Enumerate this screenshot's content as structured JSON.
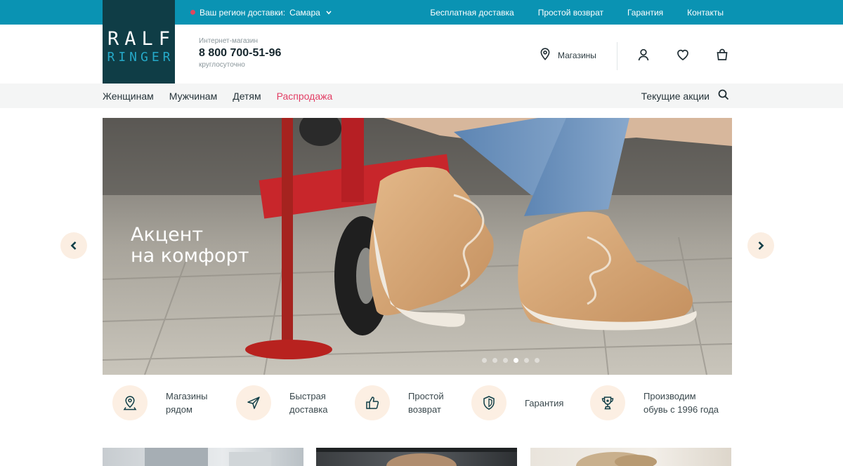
{
  "topbar": {
    "region_label": "Ваш регион доставки:",
    "region_city": "Самара",
    "links": [
      "Бесплатная доставка",
      "Простой возврат",
      "Гарантия",
      "Контакты"
    ]
  },
  "logo": {
    "line1": "RALF",
    "line2": "RINGER"
  },
  "header": {
    "phone_caption": "Интернет-магазин",
    "phone": "8 800 700-51-96",
    "phone_sub": "круглосуточно",
    "stores_label": "Магазины"
  },
  "nav": {
    "items": [
      "Женщинам",
      "Мужчинам",
      "Детям",
      "Распродажа"
    ],
    "promo": "Текущие акции"
  },
  "hero": {
    "title_line1": "Акцент",
    "title_line2": "на комфорт",
    "slides_total": 6,
    "active_slide": 4
  },
  "features": [
    {
      "line1": "Магазины",
      "line2": "рядом",
      "icon": "map-pin-icon"
    },
    {
      "line1": "Быстрая",
      "line2": "доставка",
      "icon": "send-icon"
    },
    {
      "line1": "Простой",
      "line2": "возврат",
      "icon": "thumbs-up-icon"
    },
    {
      "line1": "Гарантия",
      "line2": "",
      "icon": "shield-icon"
    },
    {
      "line1": "Производим",
      "line2": "обувь с 1996 года",
      "icon": "trophy-icon"
    }
  ],
  "colors": {
    "topbar": "#0a93b3",
    "logo_bg": "#0f3d46",
    "sale": "#e23d64",
    "feature_circle": "#fcefe3"
  }
}
